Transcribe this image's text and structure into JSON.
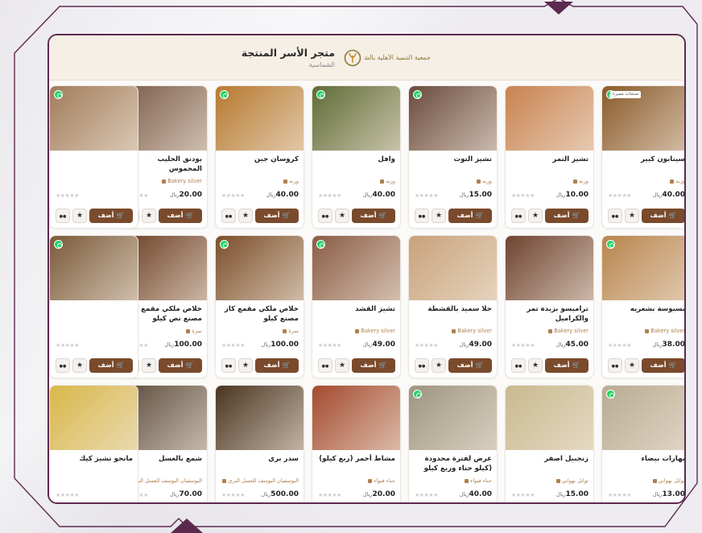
{
  "header": {
    "title": "متجر الأسر المنتجة",
    "subtitle": "الشماسية",
    "logo_text": "جمعية التنمية الأهلية بالشماسية"
  },
  "labels": {
    "order": "أضف",
    "currency": "ريال",
    "stars": "★★★★★",
    "fav": "★",
    "chat": "●●"
  },
  "colors": {
    "brand": "#5d2a4f",
    "button": "#7a4a2c",
    "category": "#b07f4e",
    "whatsapp": "#25d366"
  },
  "products": [
    {
      "name": "سينابون كبير",
      "category": "وزنه",
      "price": "40.00",
      "tag": "منتجات مميزة",
      "img": "#8a5a2a",
      "whatsapp": true
    },
    {
      "name": "تشيز التمر",
      "category": "وزنه",
      "price": "10.00",
      "img": "#c9824f",
      "whatsapp": false
    },
    {
      "name": "تشيز التوت",
      "category": "وزنه",
      "price": "15.00",
      "img": "#6a4b3e",
      "whatsapp": true
    },
    {
      "name": "وافل",
      "category": "وزنه",
      "price": "40.00",
      "img": "#5f6b35",
      "whatsapp": true
    },
    {
      "name": "كروسان جبن",
      "category": "وزنه",
      "price": "40.00",
      "img": "#b7792f",
      "whatsapp": true
    },
    {
      "name": "بودنق الحليب المحموس",
      "category": "Bakery silver",
      "price": "20.00",
      "img": "#7a5a46",
      "whatsapp": true
    },
    {
      "name": "",
      "category": "",
      "price": "",
      "img": "#a17c5b",
      "whatsapp": true
    },
    {
      "name": "بسبوسة بشعريه",
      "category": "Bakery silver",
      "price": "38.00",
      "img": "#b8844c",
      "whatsapp": true
    },
    {
      "name": "تراميسو بزبدة تمر والكراميل",
      "category": "Bakery silver",
      "price": "45.00",
      "img": "#6e4330",
      "whatsapp": false
    },
    {
      "name": "حلا سميد بالقشطة",
      "category": "Bakery silver",
      "price": "49.00",
      "img": "#c8a27a",
      "whatsapp": false
    },
    {
      "name": "تشيز القشد",
      "category": "Bakery silver",
      "price": "49.00",
      "img": "#8a5c45",
      "whatsapp": true
    },
    {
      "name": "خلاص ملكي مقمع كاز مصنع كيلو",
      "category": "تمرة",
      "price": "100.00",
      "img": "#7b4f2b",
      "whatsapp": true
    },
    {
      "name": "خلاص ملكي مقمع كاز مصنع نص كيلو",
      "category": "تمرة",
      "price": "100.00",
      "img": "#6a3d22",
      "whatsapp": true
    },
    {
      "name": "",
      "category": "",
      "price": "",
      "img": "#7a5a3a",
      "whatsapp": true
    },
    {
      "name": "بهارات بيضاء",
      "category": "توابل نهواني",
      "price": "13.00",
      "img": "#b8ab92",
      "whatsapp": true
    },
    {
      "name": "زنجبيل اصفر",
      "category": "توابل نهواني",
      "price": "15.00",
      "img": "#c9b98f",
      "whatsapp": false
    },
    {
      "name": "عرض لفترة محدودة (كيلو حناء وربع كيلو سدر )",
      "category": "حناء فيواء",
      "price": "40.00",
      "img": "#9d9580",
      "whatsapp": true
    },
    {
      "name": "مشاط أحمر (ربع كيلو)",
      "category": "حناء فيواء",
      "price": "20.00",
      "img": "#a44a2e",
      "whatsapp": false
    },
    {
      "name": "سدر بري",
      "category": "البوسفيان اليوسف للعسل البري",
      "price": "500.00",
      "img": "#4a3420",
      "whatsapp": false
    },
    {
      "name": "شمع بالعسل",
      "category": "البوسفيان اليوسف للعسل البري",
      "price": "70.00",
      "img": "#5a4a3a",
      "whatsapp": true
    },
    {
      "name": "مانجو تشيز كيك",
      "category": "",
      "price": "",
      "img": "#d8b84a",
      "whatsapp": false
    }
  ]
}
